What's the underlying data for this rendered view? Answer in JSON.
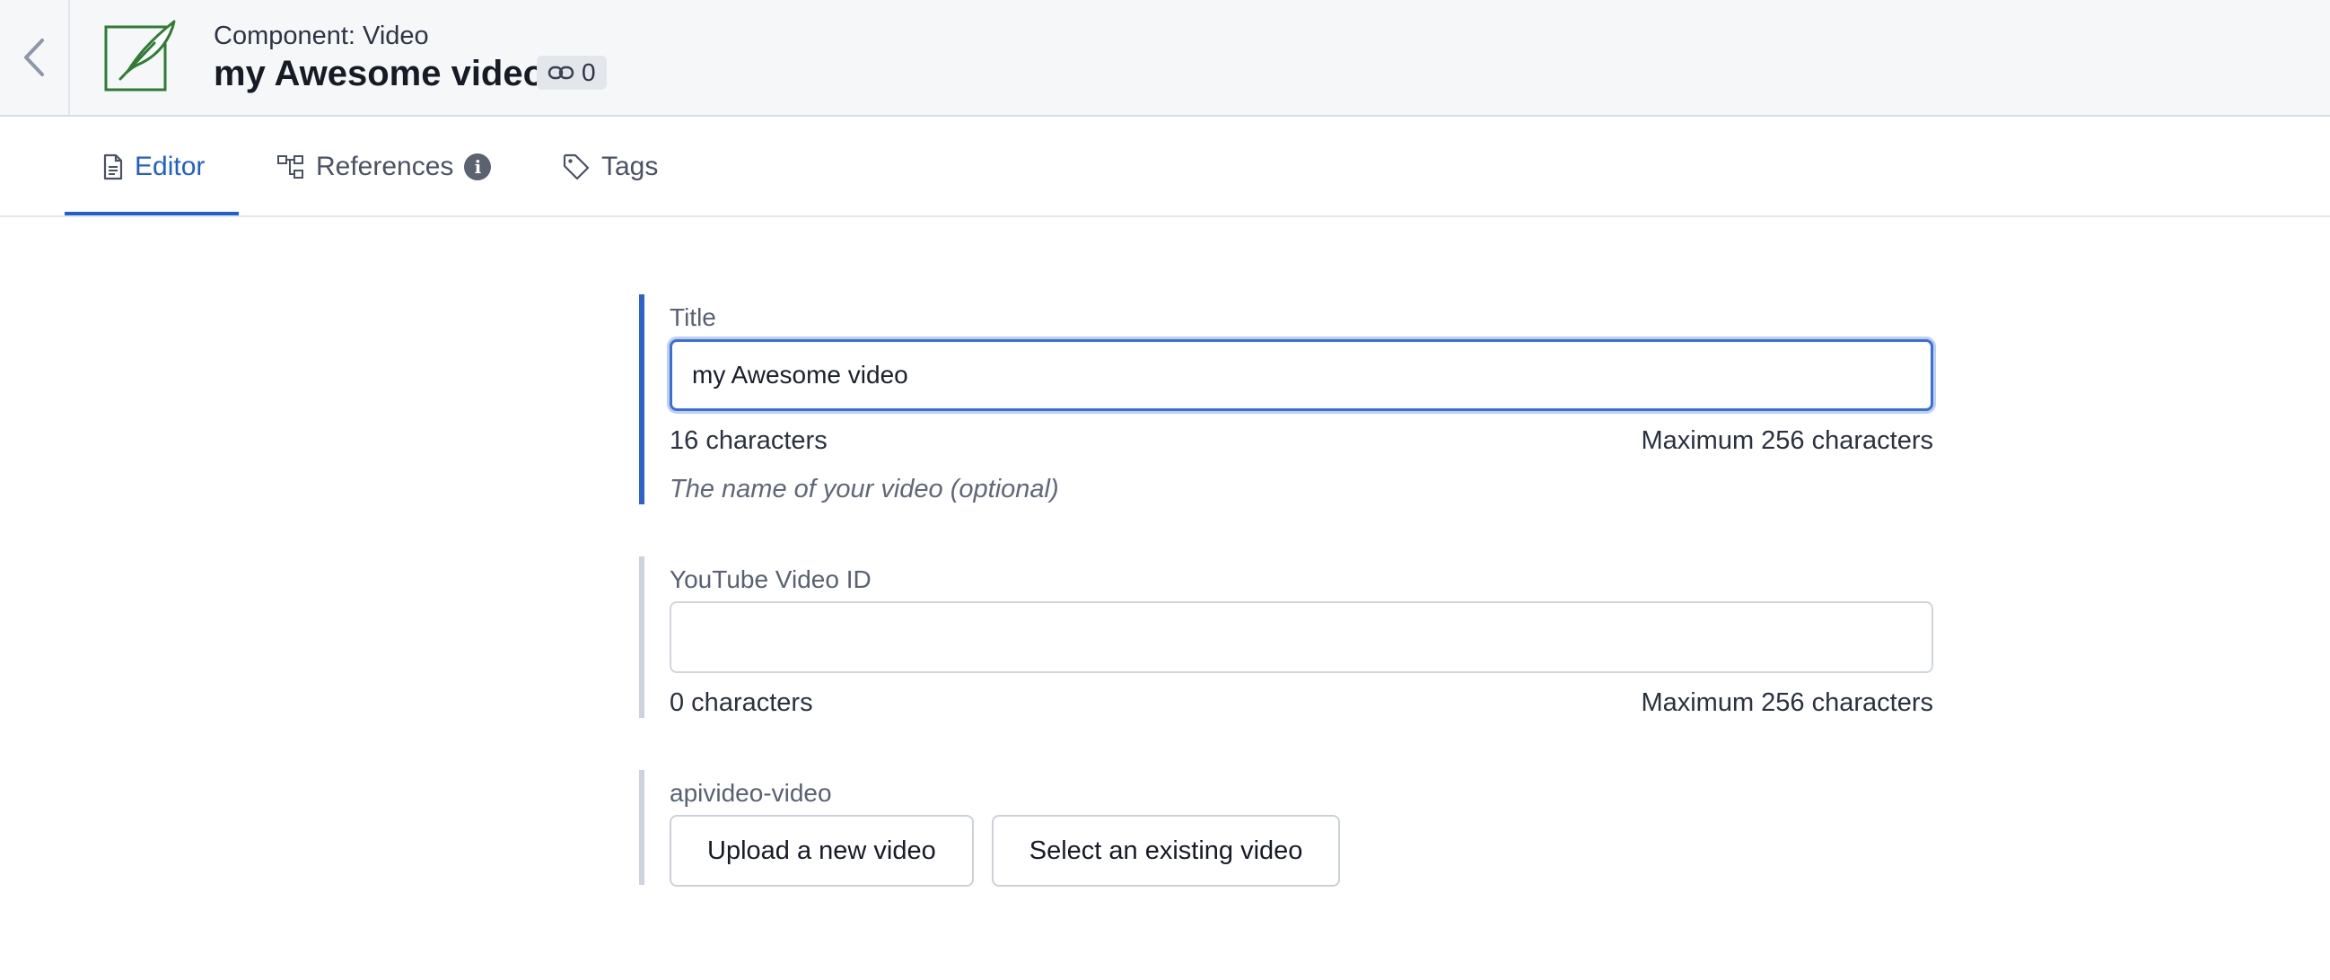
{
  "header": {
    "component_type": "Component: Video",
    "title": "my Awesome video",
    "references_count": "0"
  },
  "tabs": [
    {
      "label": "Editor",
      "active": true
    },
    {
      "label": "References",
      "active": false
    },
    {
      "label": "Tags",
      "active": false
    }
  ],
  "fields": {
    "title": {
      "label": "Title",
      "value": "my Awesome video",
      "char_count": "16 characters",
      "max": "Maximum 256 characters",
      "help": "The name of your video (optional)"
    },
    "youtube": {
      "label": "YouTube Video ID",
      "value": "",
      "char_count": "0 characters",
      "max": "Maximum 256 characters"
    },
    "apivideo": {
      "label": "apivideo-video",
      "upload_button": "Upload a new video",
      "select_button": "Select an existing video"
    }
  },
  "colors": {
    "accent": "#1f5fcf",
    "icon_green": "#2e7d32"
  }
}
